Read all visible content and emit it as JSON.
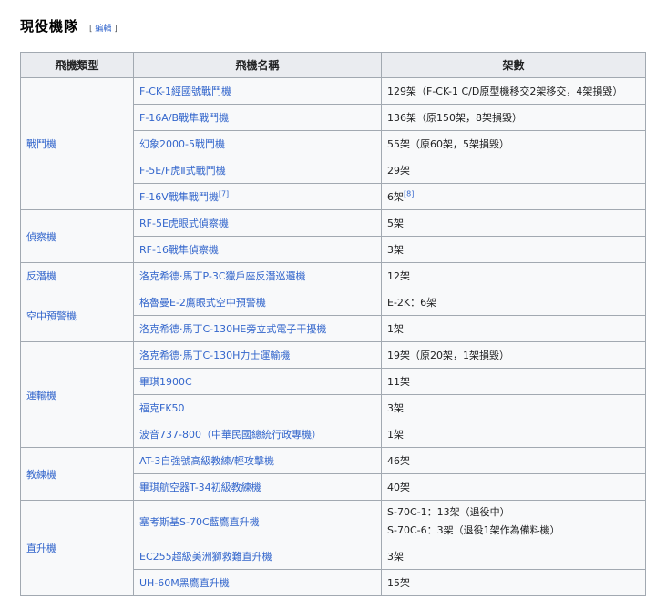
{
  "section": {
    "title": "現役機隊",
    "edit_open": "[",
    "edit_label": "編輯",
    "edit_close": "]"
  },
  "table": {
    "headers": [
      "飛機類型",
      "飛機名稱",
      "架數"
    ],
    "groups": [
      {
        "type": "戰鬥機",
        "rows": [
          {
            "name": "F-CK-1經國號戰鬥機",
            "count": "129架（F-CK-1 C/D原型機移交2架移交，4架損毀）"
          },
          {
            "name": "F-16A/B戰隼戰鬥機",
            "count": "136架（原150架，8架損毀）"
          },
          {
            "name": "幻象2000-5戰鬥機",
            "count": "55架（原60架，5架損毀）"
          },
          {
            "name": "F-5E/F虎Ⅱ式戰鬥機",
            "count": "29架"
          },
          {
            "name": "F-16V戰隼戰鬥機",
            "name_ref": "[7]",
            "count": "6架",
            "count_ref": "[8]"
          }
        ]
      },
      {
        "type": "偵察機",
        "rows": [
          {
            "name": "RF-5E虎眼式偵察機",
            "count": "5架"
          },
          {
            "name": "RF-16戰隼偵察機",
            "count": "3架"
          }
        ]
      },
      {
        "type": "反潛機",
        "rows": [
          {
            "name": "洛克希德·馬丁P-3C獵戶座反潛巡邏機",
            "count": "12架"
          }
        ]
      },
      {
        "type": "空中預警機",
        "rows": [
          {
            "name": "格魯曼E-2鷹眼式空中預警機",
            "count": "E-2K：6架"
          },
          {
            "name": "洛克希德·馬丁C-130HE旁立式電子干擾機",
            "count": "1架"
          }
        ]
      },
      {
        "type": "運輸機",
        "rows": [
          {
            "name": "洛克希德·馬丁C-130H力士運輸機",
            "count": "19架（原20架，1架損毀）"
          },
          {
            "name": "畢琪1900C",
            "count": "11架"
          },
          {
            "name": "福克FK50",
            "count": "3架"
          },
          {
            "name": "波音737-800（中華民國總統行政專機）",
            "count": "1架"
          }
        ]
      },
      {
        "type": "教練機",
        "rows": [
          {
            "name": "AT-3自強號高級教練/輕攻擊機",
            "count": "46架"
          },
          {
            "name": "畢琪航空器T-34初級教練機",
            "count": "40架"
          }
        ]
      },
      {
        "type": "直升機",
        "rows": [
          {
            "name": "塞考斯基S-70C藍鷹直升機",
            "count_lines": [
              "S-70C-1：13架（退役中）",
              "S-70C-6：3架（退役1架作為備料機）"
            ]
          },
          {
            "name": "EC255超級美洲獅救難直升機",
            "count": "3架"
          },
          {
            "name": "UH-60M黑鷹直升機",
            "count": "15架"
          }
        ]
      }
    ]
  }
}
